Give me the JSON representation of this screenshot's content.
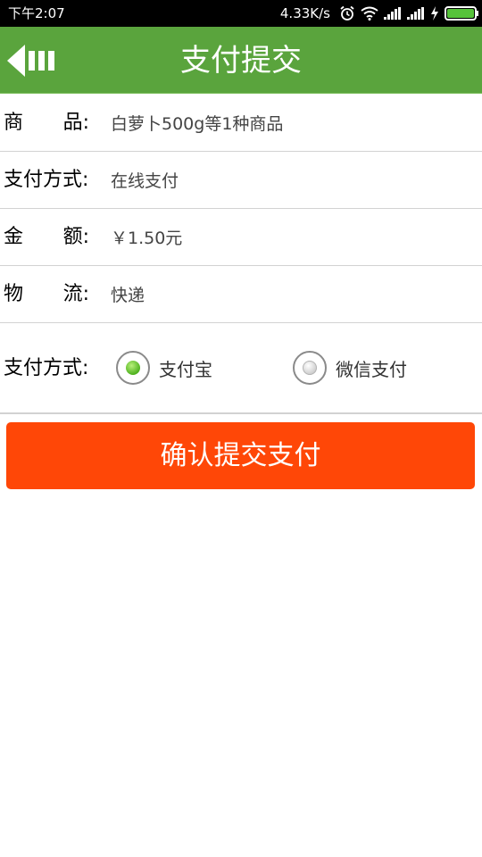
{
  "status_bar": {
    "time": "下午2:07",
    "net_speed": "4.33K/s",
    "icons": [
      "alarm-icon",
      "wifi-icon",
      "signal-icon",
      "signal-icon",
      "charging-icon",
      "battery-icon"
    ],
    "battery_color": "#56c23a"
  },
  "app_bar": {
    "title": "支付提交",
    "back_icon": "back-arrow-icon",
    "color": "#5aa43d"
  },
  "order": {
    "product_label_chars": [
      "商",
      "品:"
    ],
    "product_value": "白萝卜500g等1种商品",
    "method_label": "支付方式:",
    "method_value": "在线支付",
    "amount_label_chars": [
      "金",
      "额:"
    ],
    "amount_value": "￥1.50元",
    "shipping_label_chars": [
      "物",
      "流:"
    ],
    "shipping_value": "快递"
  },
  "payment": {
    "label": "支付方式:",
    "options": [
      {
        "label": "支付宝",
        "selected": true
      },
      {
        "label": "微信支付",
        "selected": false
      }
    ]
  },
  "confirm_button": {
    "label": "确认提交支付",
    "color": "#ff4707"
  }
}
